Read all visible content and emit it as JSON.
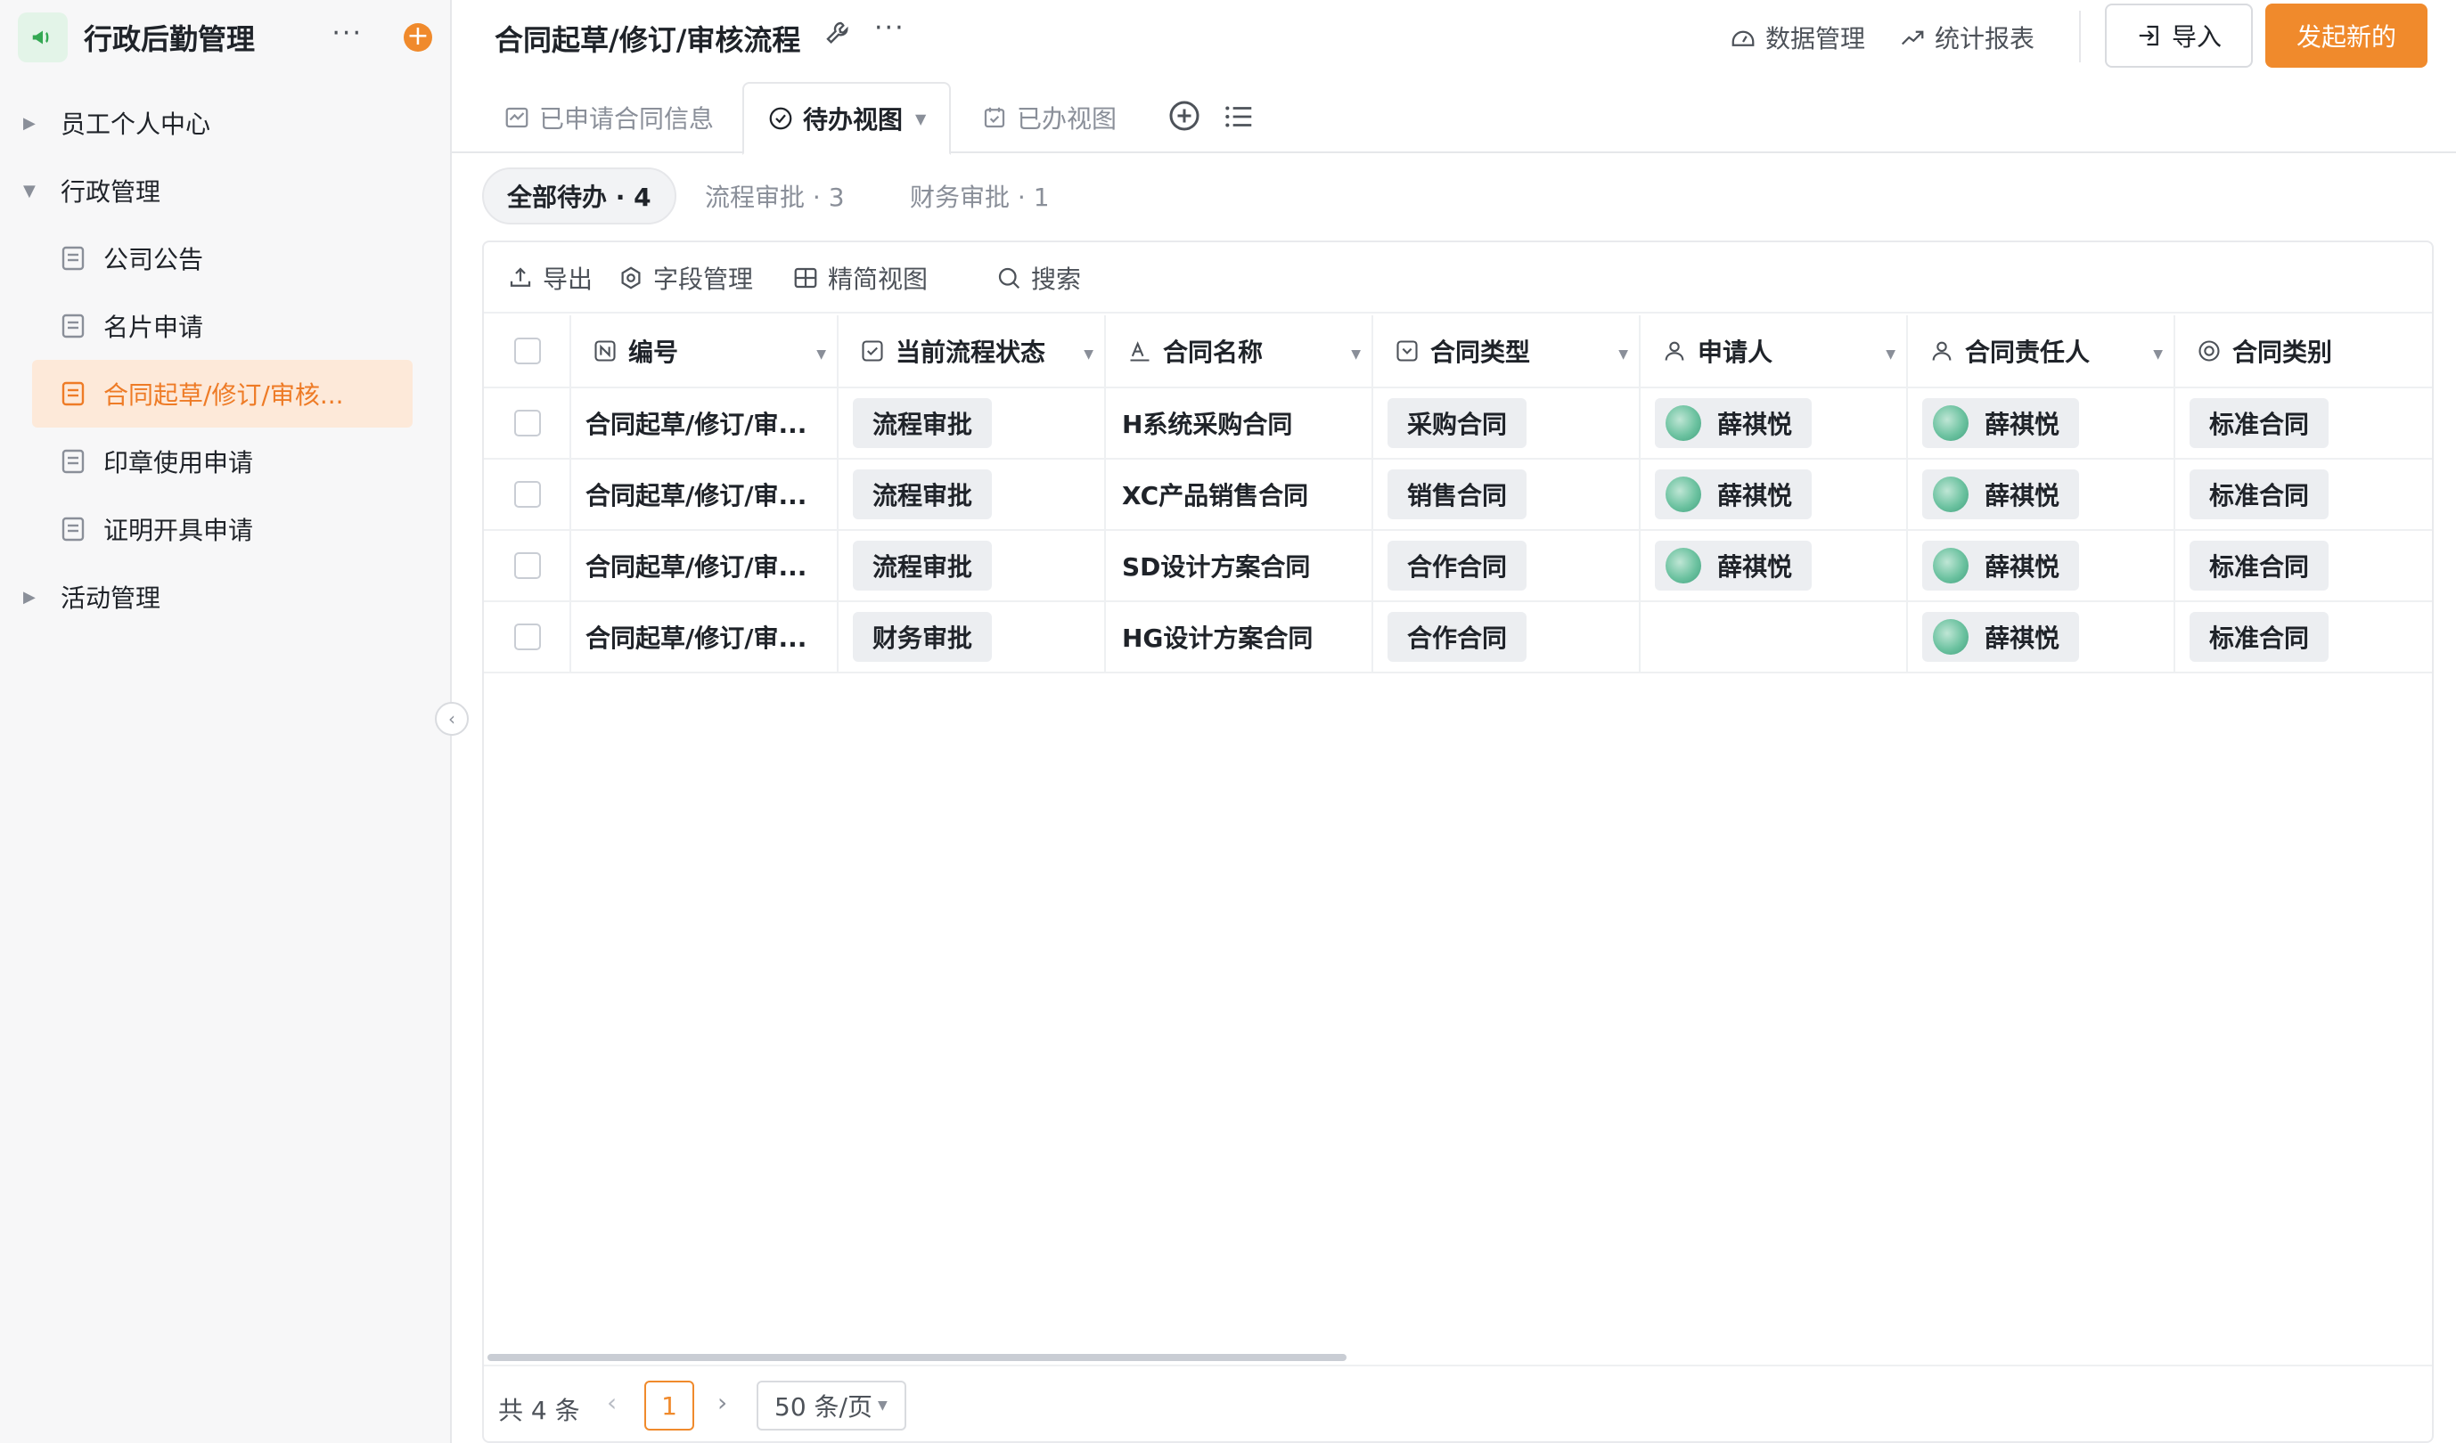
{
  "sidebar": {
    "app_title": "行政后勤管理",
    "more_label": "···",
    "add_label": "+",
    "tree": [
      {
        "label": "员工个人中心",
        "type": "group",
        "expanded": false
      },
      {
        "label": "行政管理",
        "type": "group",
        "expanded": true
      },
      {
        "label": "公司公告",
        "type": "child"
      },
      {
        "label": "名片申请",
        "type": "child"
      },
      {
        "label": "合同起草/修订/审核...",
        "type": "child",
        "active": true
      },
      {
        "label": "印章使用申请",
        "type": "child"
      },
      {
        "label": "证明开具申请",
        "type": "child"
      },
      {
        "label": "活动管理",
        "type": "group",
        "expanded": false
      }
    ],
    "collapse_glyph": "‹"
  },
  "header": {
    "title": "合同起草/修订/审核流程",
    "more_label": "···",
    "data_mgmt": "数据管理",
    "stats_report": "统计报表",
    "import_label": "导入",
    "start_label": "发起新的"
  },
  "tabs": [
    {
      "label": "已申请合同信息"
    },
    {
      "label": "待办视图",
      "active": true
    },
    {
      "label": "已办视图"
    }
  ],
  "filters": [
    {
      "label": "全部待办 · 4",
      "active": true
    },
    {
      "label": "流程审批 · 3"
    },
    {
      "label": "财务审批 · 1"
    }
  ],
  "toolbar": {
    "export": "导出",
    "fields": "字段管理",
    "compact": "精简视图",
    "search": "搜索"
  },
  "table": {
    "columns": [
      "编号",
      "当前流程状态",
      "合同名称",
      "合同类型",
      "申请人",
      "合同责任人",
      "合同类别"
    ],
    "rows": [
      {
        "id": "合同起草/修订/审...",
        "status": "流程审批",
        "name": "H系统采购合同",
        "type": "采购合同",
        "applicant": "薛祺悦",
        "owner": "薛祺悦",
        "category": "标准合同"
      },
      {
        "id": "合同起草/修订/审...",
        "status": "流程审批",
        "name": "XC产品销售合同",
        "type": "销售合同",
        "applicant": "薛祺悦",
        "owner": "薛祺悦",
        "category": "标准合同"
      },
      {
        "id": "合同起草/修订/审...",
        "status": "流程审批",
        "name": "SD设计方案合同",
        "type": "合作合同",
        "applicant": "薛祺悦",
        "owner": "薛祺悦",
        "category": "标准合同"
      },
      {
        "id": "合同起草/修订/审...",
        "status": "财务审批",
        "name": "HG设计方案合同",
        "type": "合作合同",
        "applicant": "",
        "owner": "薛祺悦",
        "category": "标准合同"
      }
    ]
  },
  "pagination": {
    "total": "共 4 条",
    "current": "1",
    "page_size": "50 条/页",
    "prev": "‹",
    "next": "›"
  },
  "colors": {
    "accent": "#f08a2c",
    "active_bg": "#fde9d9",
    "tag_bg": "#eceef1"
  }
}
